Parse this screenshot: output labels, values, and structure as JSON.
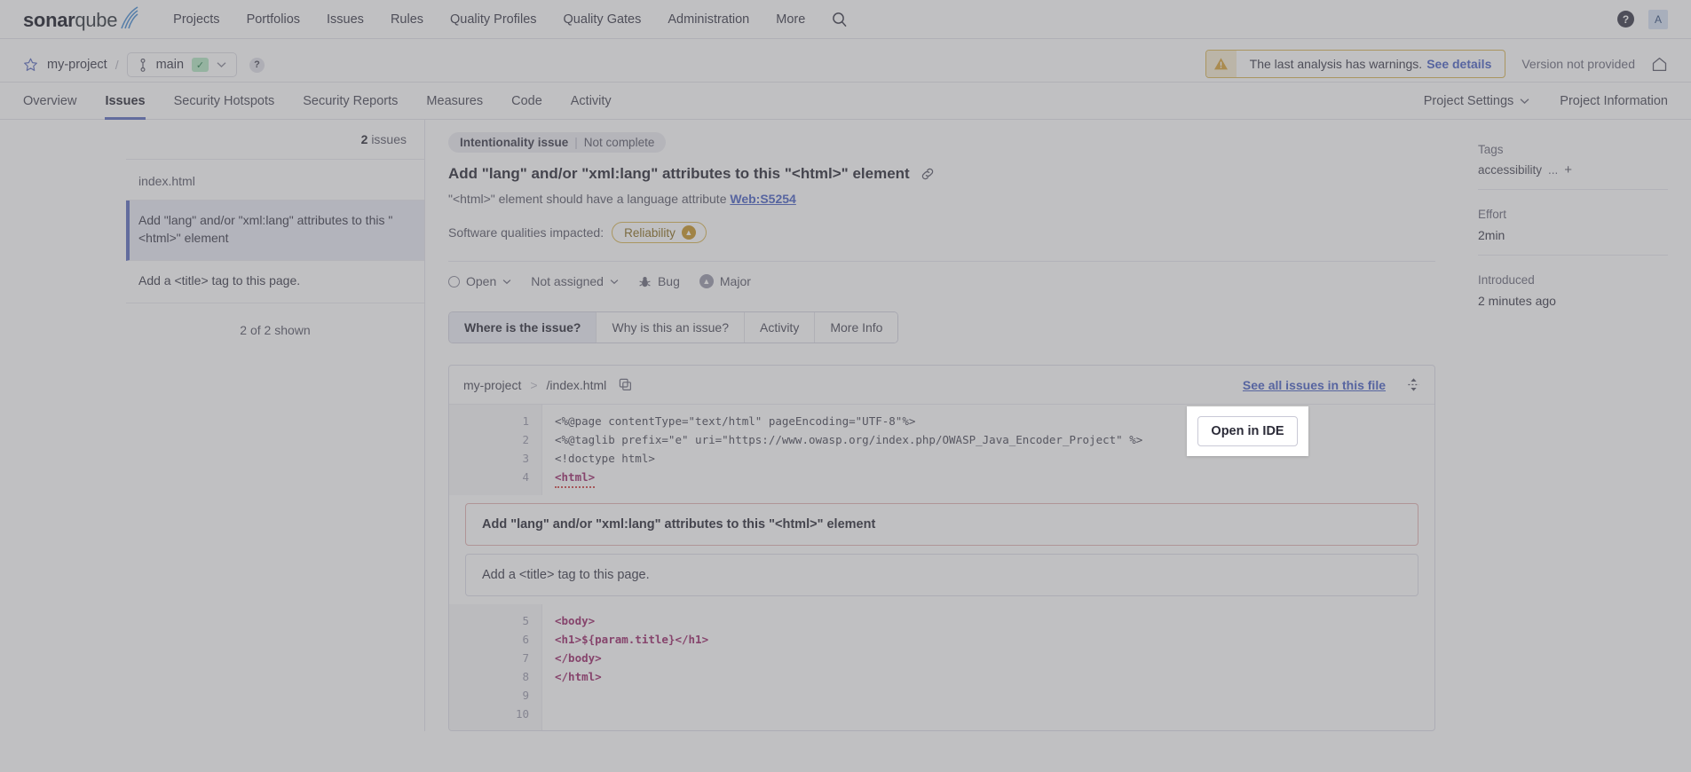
{
  "global_nav": {
    "logo": {
      "bold": "sonar",
      "light": "qube"
    },
    "items": [
      {
        "label": "Projects"
      },
      {
        "label": "Portfolios"
      },
      {
        "label": "Issues"
      },
      {
        "label": "Rules"
      },
      {
        "label": "Quality Profiles"
      },
      {
        "label": "Quality Gates"
      },
      {
        "label": "Administration"
      },
      {
        "label": "More"
      }
    ],
    "search_icon": "search-icon",
    "help_badge": "?",
    "avatar_initial": "A"
  },
  "project_header": {
    "project_name": "my-project",
    "separator": "/",
    "branch": "main",
    "quality_gate_state": "passed",
    "help_badge": "?",
    "warning": {
      "text": "The last analysis has warnings.",
      "link": "See details"
    },
    "version": "Version not provided",
    "home_icon": "home-icon"
  },
  "tabs": {
    "items": [
      {
        "label": "Overview",
        "active": false
      },
      {
        "label": "Issues",
        "active": true
      },
      {
        "label": "Security Hotspots",
        "active": false
      },
      {
        "label": "Security Reports",
        "active": false
      },
      {
        "label": "Measures",
        "active": false
      },
      {
        "label": "Code",
        "active": false
      },
      {
        "label": "Activity",
        "active": false
      }
    ],
    "right": [
      {
        "label": "Project Settings"
      },
      {
        "label": "Project Information"
      }
    ]
  },
  "sidebar": {
    "count_number": "2",
    "count_label": "issues",
    "file_name": "index.html",
    "issues": [
      {
        "text": "Add \"lang\" and/or \"xml:lang\" attributes to this \"<html>\" element",
        "selected": true
      },
      {
        "text": "Add a <title> tag to this page.",
        "selected": false
      }
    ],
    "shown_count": "2 of 2 shown"
  },
  "issue": {
    "badge_primary": "Intentionality issue",
    "badge_separator": "|",
    "badge_secondary": "Not complete",
    "title": "Add \"lang\" and/or \"xml:lang\" attributes to this \"<html>\" element",
    "link_icon": "link-icon",
    "description": "\"<html>\" element should have a language attribute",
    "rule_key": "Web:S5254",
    "software_qualities_label": "Software qualities impacted:",
    "software_quality": "Reliability",
    "status": "Open",
    "assignee": "Not assigned",
    "type": "Bug",
    "severity": "Major",
    "segmented_tabs": [
      {
        "label": "Where is the issue?",
        "active": true
      },
      {
        "label": "Why is this an issue?",
        "active": false
      },
      {
        "label": "Activity",
        "active": false
      },
      {
        "label": "More Info",
        "active": false
      }
    ]
  },
  "code_viewer": {
    "breadcrumb_project": "my-project",
    "breadcrumb_sep": ">",
    "breadcrumb_file": "/index.html",
    "copy_icon": "copy-icon",
    "see_all_link": "See all issues in this file",
    "expand_icon": "expand-collapse-icon",
    "line_numbers_before": [
      "1",
      "2",
      "3",
      "4"
    ],
    "lines_before": [
      "<%@page contentType=\"text/html\" pageEncoding=\"UTF-8\"%>",
      "<%@taglib prefix=\"e\" uri=\"https://www.owasp.org/index.php/OWASP_Java_Encoder_Project\" %>",
      "<!doctype html>",
      "<html>"
    ],
    "inline_messages": [
      {
        "text": "Add \"lang\" and/or \"xml:lang\" attributes to this \"<html>\" element",
        "primary": true
      },
      {
        "text": "Add a <title> tag to this page.",
        "primary": false
      }
    ],
    "line_numbers_after": [
      "5",
      "6",
      "7",
      "8",
      "9",
      "10"
    ],
    "lines_after": [
      "  <body>",
      "    <h1>${param.title}</h1>",
      "  </body>",
      "</html>",
      "",
      ""
    ]
  },
  "right_column": {
    "tags_label": "Tags",
    "tag": "accessibility",
    "tag_more": "...",
    "tag_add": "+",
    "effort_label": "Effort",
    "effort_value": "2min",
    "introduced_label": "Introduced",
    "introduced_value": "2 minutes ago"
  },
  "popup": {
    "open_in_ide": "Open in IDE"
  },
  "colors": {
    "accent": "#5e6ebf",
    "link": "#4b62c4",
    "warning_border": "#d9b757",
    "quality_gate_ok": "#b6e8c4",
    "severity_major": "#9a9aab",
    "reliability": "#c9962a"
  }
}
